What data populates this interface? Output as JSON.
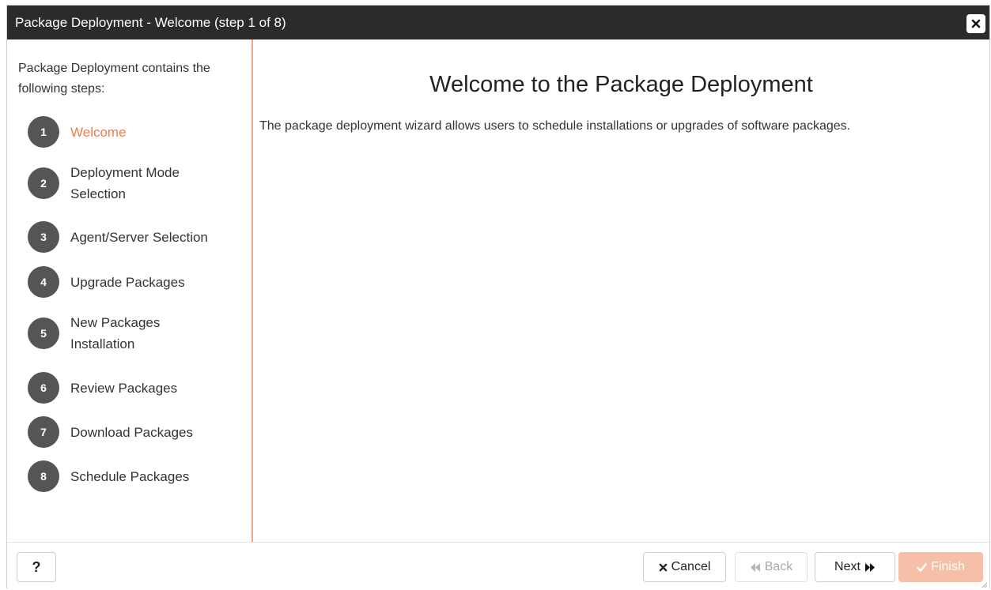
{
  "window": {
    "title": "Package Deployment - Welcome (step 1 of 8)",
    "close_icon": "close-icon"
  },
  "sidebar": {
    "intro": "Package Deployment contains the following steps:",
    "active_step": 1,
    "steps": [
      {
        "number": "1",
        "label": "Welcome"
      },
      {
        "number": "2",
        "label": "Deployment Mode Selection"
      },
      {
        "number": "3",
        "label": "Agent/Server Selection"
      },
      {
        "number": "4",
        "label": "Upgrade Packages"
      },
      {
        "number": "5",
        "label": "New Packages Installation"
      },
      {
        "number": "6",
        "label": "Review Packages"
      },
      {
        "number": "7",
        "label": "Download Packages"
      },
      {
        "number": "8",
        "label": "Schedule Packages"
      }
    ]
  },
  "main": {
    "heading": "Welcome to the Package Deployment",
    "description": "The package deployment wizard allows users to schedule installations or upgrades of software packages."
  },
  "footer": {
    "help_label": "?",
    "cancel_label": "Cancel",
    "back_label": "Back",
    "next_label": "Next",
    "finish_label": "Finish"
  },
  "colors": {
    "titlebar": "#2b2b2b",
    "accent": "#ef7b52",
    "divider": "#f2a689",
    "finish_bg": "#f6c0a8",
    "step_circle": "#555555"
  }
}
